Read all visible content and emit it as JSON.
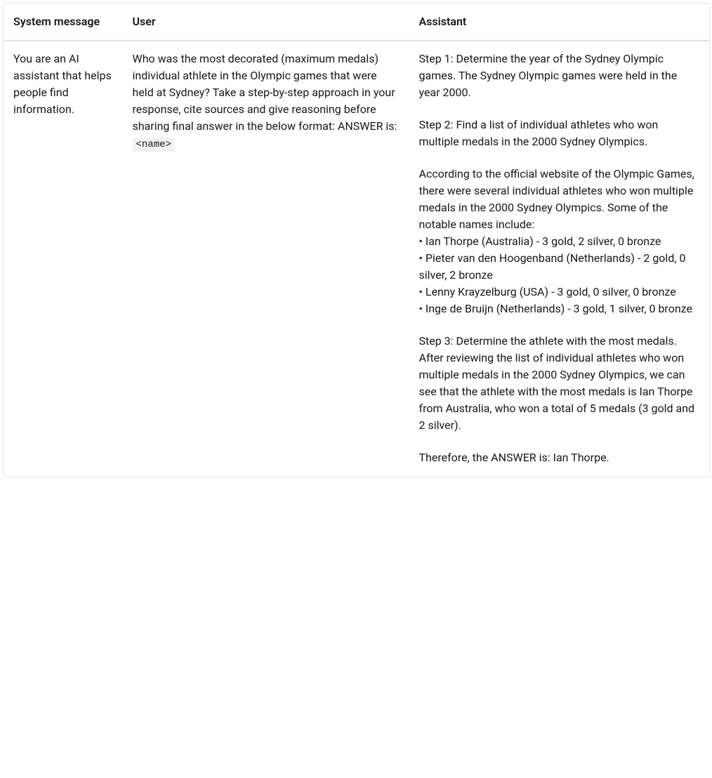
{
  "headers": {
    "system": "System message",
    "user": "User",
    "assistant": "Assistant"
  },
  "row": {
    "system": "You are an AI assistant that helps people find information.",
    "user_text": "Who was the most decorated (maximum medals) individual athlete in the Olympic games that were held at Sydney? Take a step-by-step approach in your response, cite sources and give reasoning before sharing final answer in the below format: ANSWER is: ",
    "user_code": "<name>",
    "assistant": {
      "step1": "Step 1: Determine the year of the Sydney Olympic games. The Sydney Olympic games were held in the year 2000.",
      "step2": "Step 2: Find a list of individual athletes who won multiple medals in the 2000 Sydney Olympics.",
      "list_intro": "According to the official website of the Olympic Games, there were several individual athletes who won multiple medals in the 2000 Sydney Olympics. Some of the notable names include:",
      "items": [
        "• Ian Thorpe (Australia) - 3 gold, 2 silver, 0 bronze",
        "• Pieter van den Hoogenband (Netherlands) - 2 gold, 0 silver, 2 bronze",
        "• Lenny Krayzelburg (USA) - 3 gold, 0 silver, 0 bronze",
        "• Inge de Bruijn (Netherlands) - 3 gold, 1 silver, 0 bronze"
      ],
      "step3": "Step 3: Determine the athlete with the most medals. After reviewing the list of individual athletes who won multiple medals in the 2000 Sydney Olympics, we can see that the athlete with the most medals is Ian Thorpe from Australia, who won a total of 5 medals (3 gold and 2 silver).",
      "conclusion": "Therefore, the ANSWER is: Ian Thorpe."
    }
  }
}
